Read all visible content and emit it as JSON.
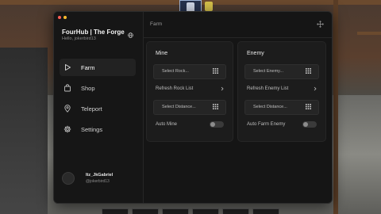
{
  "app": {
    "title": "FourHub | The Forge",
    "subtitle": "Hello, jokerbird13"
  },
  "sidebar": {
    "items": [
      {
        "label": "Farm",
        "icon": "play-icon",
        "active": true
      },
      {
        "label": "Shop",
        "icon": "bag-icon",
        "active": false
      },
      {
        "label": "Teleport",
        "icon": "map-pin-icon",
        "active": false
      },
      {
        "label": "Settings",
        "icon": "gear-icon",
        "active": false
      }
    ]
  },
  "user": {
    "name": "Itz_JkGabriel",
    "handle": "@jokerbird13"
  },
  "header": {
    "breadcrumb": "Farm"
  },
  "mine": {
    "title": "Mine",
    "select_rock": "Select Rock...",
    "refresh_label": "Refresh Rock List",
    "select_distance": "Select Distance...",
    "toggle_label": "Auto Mine",
    "toggle_on": false
  },
  "enemy": {
    "title": "Enemy",
    "select_enemy": "Select Enemy...",
    "refresh_label": "Refresh Enemy List",
    "select_distance": "Select Distance...",
    "toggle_label": "Auto Farm Enemy",
    "toggle_on": false
  },
  "colors": {
    "close_dot": "#ff5f57",
    "minimize_dot": "#febc2e",
    "window_bg": "#151515",
    "card_bg": "#1c1c1c"
  }
}
